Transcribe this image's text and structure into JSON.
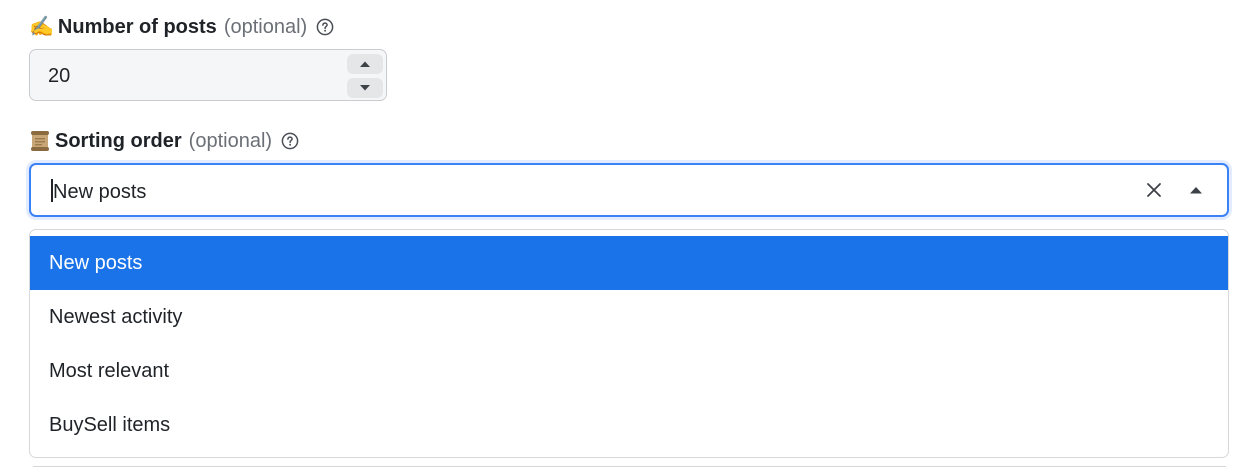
{
  "posts_field": {
    "emoji": "✍️",
    "title": "Number of posts",
    "optional": "(optional)",
    "help_icon": "question-circle-icon",
    "value": "20",
    "increment_icon": "triangle-up-icon",
    "decrement_icon": "triangle-down-icon"
  },
  "sort_field": {
    "emoji": "📜",
    "title": "Sorting order",
    "optional": "(optional)",
    "help_icon": "question-circle-icon",
    "value": "New posts",
    "clear_icon": "close-icon",
    "toggle_icon": "triangle-up-icon",
    "options": [
      {
        "label": "New posts",
        "selected": true
      },
      {
        "label": "Newest activity",
        "selected": false
      },
      {
        "label": "Most relevant",
        "selected": false
      },
      {
        "label": "BuySell items",
        "selected": false
      }
    ]
  },
  "colors": {
    "focus_border": "#3b82f6",
    "selected_option": "#1a73e8"
  }
}
